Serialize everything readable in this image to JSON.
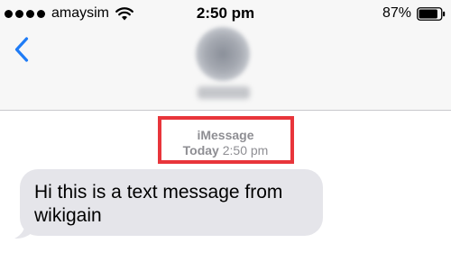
{
  "status_bar": {
    "carrier": "amaysim",
    "time": "2:50 pm",
    "battery_percent": "87%",
    "battery_level": 0.87,
    "icons": [
      "signal-dots-icon",
      "wifi-icon",
      "battery-icon"
    ]
  },
  "nav": {
    "back_icon": "chevron-left-icon",
    "accent_color": "#1f7cf6"
  },
  "conversation": {
    "service": "iMessage",
    "timestamp_day": "Today",
    "timestamp_time": "2:50 pm",
    "highlight_color": "#e8353b",
    "messages": [
      {
        "direction": "incoming",
        "text": "Hi this is a text message from wikigain"
      }
    ]
  }
}
